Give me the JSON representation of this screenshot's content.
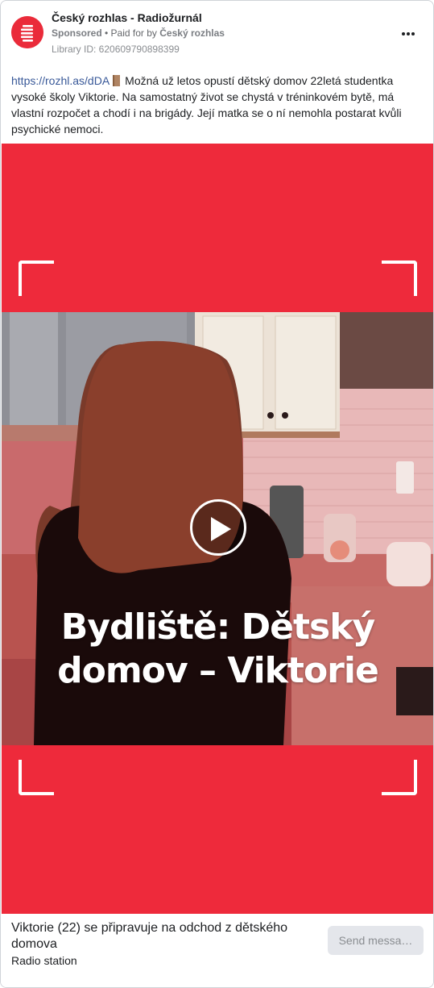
{
  "header": {
    "page_name": "Český rozhlas - Radiožurnál",
    "sponsored_label": "Sponsored",
    "paid_for_prefix": " • Paid for by ",
    "paid_for_by": "Český rozhlas",
    "library_id": "Library ID: 620609790898399",
    "more_icon": "more-horizontal-icon"
  },
  "post": {
    "link_text": "https://rozhl.as/dDA",
    "door_icon": "door-emoji",
    "body": "Možná už letos opustí dětský domov 22letá studentka vysoké školy Viktorie. Na samostatný život se chystá v tréninkovém bytě, má vlastní rozpočet a chodí i na brigády. Její matka se o ní nemohla postarat kvůli psychické nemoci."
  },
  "media": {
    "background_color": "#ee2a3b",
    "overlay_line1": "Bydliště: Dětský",
    "overlay_line2": "domov – Viktorie",
    "play_icon": "play-icon"
  },
  "footer": {
    "headline": "Viktorie (22) se připravuje na odchod z dětského domova",
    "subtitle": "Radio station",
    "cta_label": "Send messa…"
  },
  "colors": {
    "brand_red": "#ea2b3a",
    "link": "#385898",
    "muted": "#65676b"
  }
}
